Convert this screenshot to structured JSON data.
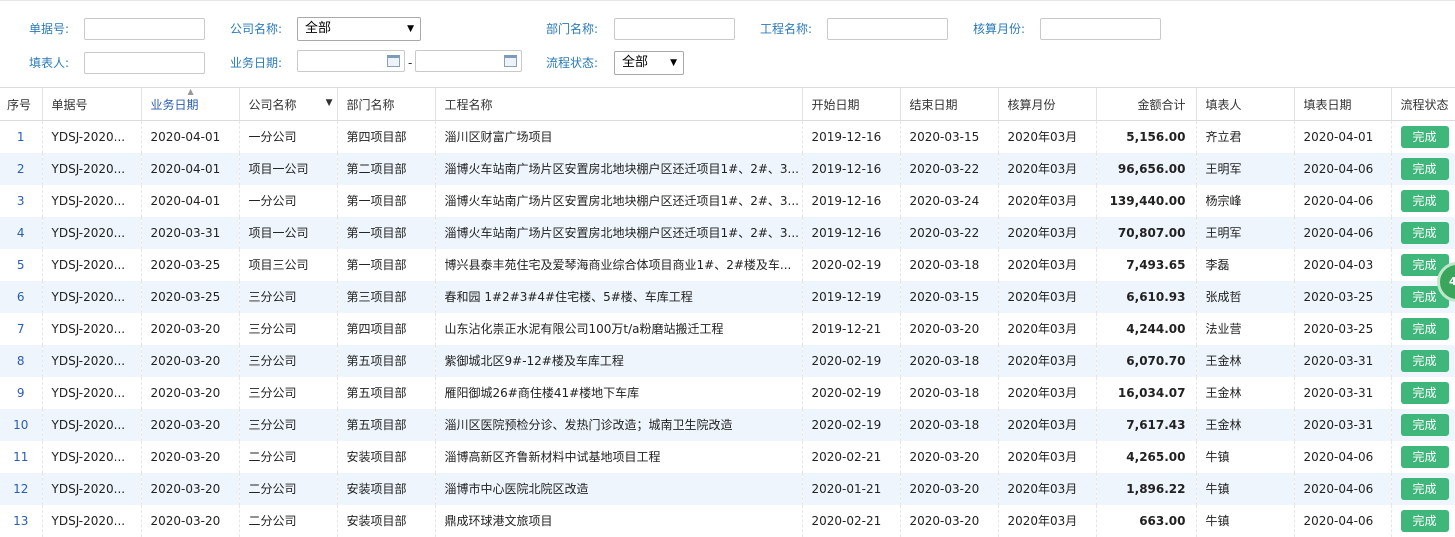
{
  "filters": {
    "doc_no_label": "单据号:",
    "company_label": "公司名称:",
    "company_value": "全部",
    "dept_label": "部门名称:",
    "project_label": "工程名称:",
    "month_label": "核算月份:",
    "filler_label": "填表人:",
    "bizdate_label": "业务日期:",
    "range_sep": "-",
    "status_label": "流程状态:",
    "status_value": "全部"
  },
  "table": {
    "headers": [
      "序号",
      "单据号",
      "业务日期",
      "公司名称",
      "部门名称",
      "工程名称",
      "开始日期",
      "结束日期",
      "核算月份",
      "金额合计",
      "填表人",
      "填表日期",
      "流程状态"
    ],
    "rows": [
      [
        "1",
        "YDSJ-2020...",
        "2020-04-01",
        "一分公司",
        "第四项目部",
        "淄川区财富广场项目",
        "2019-12-16",
        "2020-03-15",
        "2020年03月",
        "5,156.00",
        "齐立君",
        "2020-04-01",
        "完成"
      ],
      [
        "2",
        "YDSJ-2020...",
        "2020-04-01",
        "项目一公司",
        "第二项目部",
        "淄博火车站南广场片区安置房北地块棚户区还迁项目1#、2#、3...",
        "2019-12-16",
        "2020-03-22",
        "2020年03月",
        "96,656.00",
        "王明军",
        "2020-04-06",
        "完成"
      ],
      [
        "3",
        "YDSJ-2020...",
        "2020-04-01",
        "一分公司",
        "第一项目部",
        "淄博火车站南广场片区安置房北地块棚户区还迁项目1#、2#、3...",
        "2019-12-16",
        "2020-03-24",
        "2020年03月",
        "139,440.00",
        "杨宗峰",
        "2020-04-06",
        "完成"
      ],
      [
        "4",
        "YDSJ-2020...",
        "2020-03-31",
        "项目一公司",
        "第一项目部",
        "淄博火车站南广场片区安置房北地块棚户区还迁项目1#、2#、3...",
        "2019-12-16",
        "2020-03-22",
        "2020年03月",
        "70,807.00",
        "王明军",
        "2020-04-06",
        "完成"
      ],
      [
        "5",
        "YDSJ-2020...",
        "2020-03-25",
        "项目三公司",
        "第一项目部",
        "博兴县泰丰苑住宅及爱琴海商业综合体项目商业1#、2#楼及车...",
        "2020-02-19",
        "2020-03-18",
        "2020年03月",
        "7,493.65",
        "李磊",
        "2020-04-03",
        "完成"
      ],
      [
        "6",
        "YDSJ-2020...",
        "2020-03-25",
        "三分公司",
        "第三项目部",
        "春和园 1#2#3#4#住宅楼、5#楼、车库工程",
        "2019-12-19",
        "2020-03-15",
        "2020年03月",
        "6,610.93",
        "张成哲",
        "2020-03-25",
        "完成"
      ],
      [
        "7",
        "YDSJ-2020...",
        "2020-03-20",
        "三分公司",
        "第四项目部",
        "山东沾化祟正水泥有限公司100万t/a粉磨站搬迁工程",
        "2019-12-21",
        "2020-03-20",
        "2020年03月",
        "4,244.00",
        "法业营",
        "2020-03-25",
        "完成"
      ],
      [
        "8",
        "YDSJ-2020...",
        "2020-03-20",
        "三分公司",
        "第五项目部",
        "紫御城北区9#-12#楼及车库工程",
        "2020-02-19",
        "2020-03-18",
        "2020年03月",
        "6,070.70",
        "王金林",
        "2020-03-31",
        "完成"
      ],
      [
        "9",
        "YDSJ-2020...",
        "2020-03-20",
        "三分公司",
        "第五项目部",
        "雁阳御城26#商住楼41#楼地下车库",
        "2020-02-19",
        "2020-03-18",
        "2020年03月",
        "16,034.07",
        "王金林",
        "2020-03-31",
        "完成"
      ],
      [
        "10",
        "YDSJ-2020...",
        "2020-03-20",
        "三分公司",
        "第五项目部",
        "淄川区医院预检分诊、发热门诊改造；城南卫生院改造",
        "2020-02-19",
        "2020-03-18",
        "2020年03月",
        "7,617.43",
        "王金林",
        "2020-03-31",
        "完成"
      ],
      [
        "11",
        "YDSJ-2020...",
        "2020-03-20",
        "二分公司",
        "安装项目部",
        "淄博高新区齐鲁新材料中试基地项目工程",
        "2020-02-21",
        "2020-03-20",
        "2020年03月",
        "4,265.00",
        "牛镇",
        "2020-04-06",
        "完成"
      ],
      [
        "12",
        "YDSJ-2020...",
        "2020-03-20",
        "二分公司",
        "安装项目部",
        "淄博市中心医院北院区改造",
        "2020-01-21",
        "2020-03-20",
        "2020年03月",
        "1,896.22",
        "牛镇",
        "2020-04-06",
        "完成"
      ],
      [
        "13",
        "YDSJ-2020...",
        "2020-03-20",
        "二分公司",
        "安装项目部",
        "鼎成环球港文旅项目",
        "2020-02-21",
        "2020-03-20",
        "2020年03月",
        "663.00",
        "牛镇",
        "2020-04-06",
        "完成"
      ]
    ]
  },
  "float_badge": "45",
  "colors": {
    "status_complete": "#3fb77a",
    "label_blue": "#2a7ab8",
    "row_alt": "#eef5fd"
  }
}
